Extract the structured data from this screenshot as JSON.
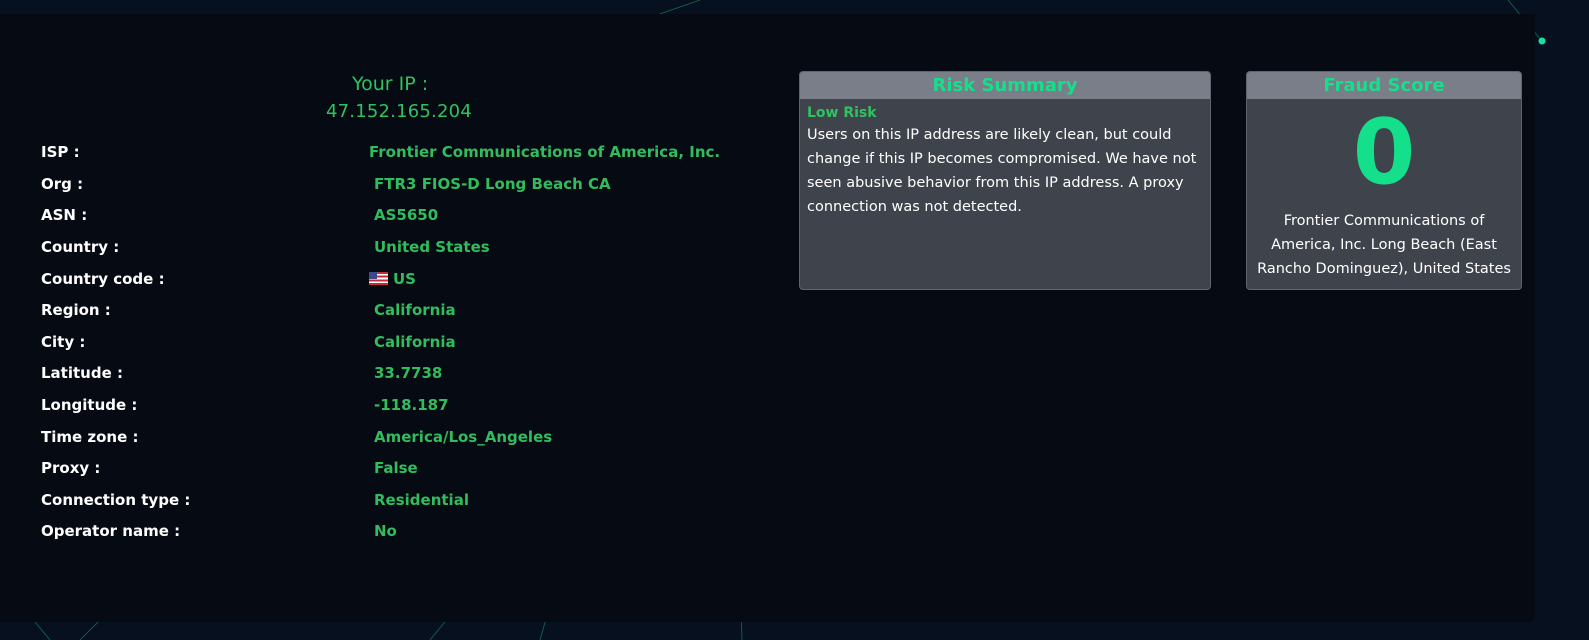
{
  "ip": {
    "label": "Your IP :",
    "value": "47.152.165.204"
  },
  "details": [
    {
      "key": "ISP :",
      "value": "Frontier Communications of America, Inc."
    },
    {
      "key": "Org :",
      "value": "FTR3 FIOS-D Long Beach CA"
    },
    {
      "key": "ASN :",
      "value": "AS5650"
    },
    {
      "key": "Country :",
      "value": "United States"
    },
    {
      "key": "Country code :",
      "value": "US"
    },
    {
      "key": "Region :",
      "value": "California"
    },
    {
      "key": "City :",
      "value": "California"
    },
    {
      "key": "Latitude :",
      "value": "33.7738"
    },
    {
      "key": "Longitude :",
      "value": "-118.187"
    },
    {
      "key": "Time zone :",
      "value": "America/Los_Angeles"
    },
    {
      "key": "Proxy :",
      "value": "False"
    },
    {
      "key": "Connection type :",
      "value": "Residential"
    },
    {
      "key": "Operator name :",
      "value": "No"
    }
  ],
  "risk_summary": {
    "title": "Risk Summary",
    "level": "Low Risk",
    "text": "Users on this IP address are likely clean, but could change if this IP becomes compromised. We have not seen abusive behavior from this IP address. A proxy connection was not detected."
  },
  "fraud_score": {
    "title": "Fraud Score",
    "score": "0",
    "description": "Frontier Communications of America, Inc. Long Beach (East Rancho Dominguez), United States"
  },
  "flag_icon": "us-flag-icon",
  "colors": {
    "background": "#050a13",
    "accent": "#14e08c",
    "value_green": "#31bd5e",
    "network_node": "#0f8a5a"
  }
}
